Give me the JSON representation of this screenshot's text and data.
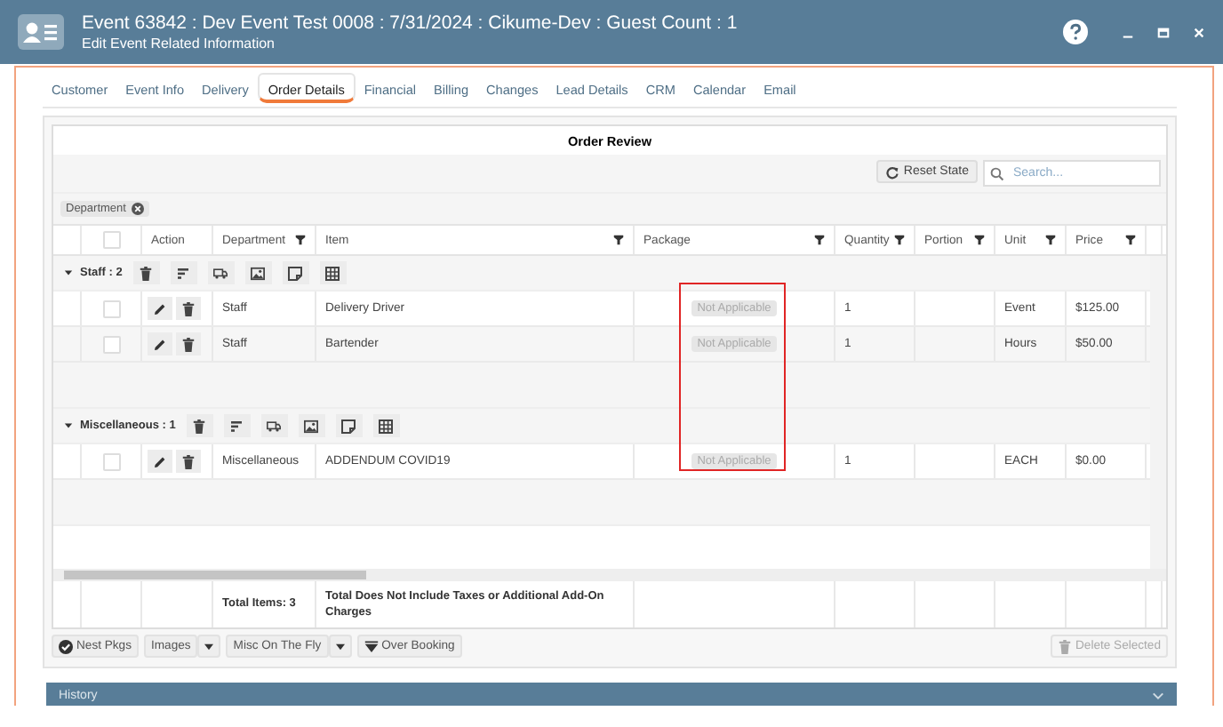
{
  "header": {
    "title": "Event 63842 : Dev Event Test 0008 : 7/31/2024 : Cikume-Dev : Guest Count : 1",
    "subtitle": "Edit Event Related Information"
  },
  "tabs": [
    {
      "label": "Customer",
      "selected": false
    },
    {
      "label": "Event Info",
      "selected": false
    },
    {
      "label": "Delivery",
      "selected": false
    },
    {
      "label": "Order Details",
      "selected": true
    },
    {
      "label": "Financial",
      "selected": false
    },
    {
      "label": "Billing",
      "selected": false
    },
    {
      "label": "Changes",
      "selected": false
    },
    {
      "label": "Lead Details",
      "selected": false
    },
    {
      "label": "CRM",
      "selected": false
    },
    {
      "label": "Calendar",
      "selected": false
    },
    {
      "label": "Email",
      "selected": false
    }
  ],
  "grid": {
    "title": "Order Review",
    "reset_button": "Reset State",
    "search": {
      "placeholder": "Search..."
    },
    "group_chip": "Department",
    "select_all_checked": false,
    "columns": [
      {
        "label": "Action",
        "filter": false
      },
      {
        "label": "Department",
        "filter": true
      },
      {
        "label": "Item",
        "filter": true
      },
      {
        "label": "Package",
        "filter": true
      },
      {
        "label": "Quantity",
        "filter": true
      },
      {
        "label": "Portion",
        "filter": true
      },
      {
        "label": "Unit",
        "filter": true
      },
      {
        "label": "Price",
        "filter": true
      }
    ],
    "groups": [
      {
        "label": "Staff : 2",
        "expanded": true,
        "rows": [
          {
            "checked": false,
            "department": "Staff",
            "item": "Delivery Driver",
            "package": "Not Applicable",
            "quantity": "1",
            "unit": "Event",
            "price": "$125.00"
          },
          {
            "checked": false,
            "department": "Staff",
            "item": "Bartender",
            "package": "Not Applicable",
            "quantity": "1",
            "unit": "Hours",
            "price": "$50.00"
          }
        ]
      },
      {
        "label": "Miscellaneous : 1",
        "expanded": true,
        "rows": [
          {
            "checked": false,
            "department": "Miscellaneous",
            "item": "ADDENDUM COVID19",
            "package": "Not Applicable",
            "quantity": "1",
            "unit": "EACH",
            "price": "$0.00"
          }
        ]
      }
    ],
    "footer": {
      "total_items": "Total Items: 3",
      "note": "Total Does Not Include Taxes or Additional Add-On Charges"
    }
  },
  "buttons": [
    {
      "label": "Nest Pkgs",
      "kind": "check"
    },
    {
      "label": "Images",
      "kind": "dropdown"
    },
    {
      "label": "Misc On The Fly",
      "kind": "dropdown"
    },
    {
      "label": "Over Booking",
      "kind": "booking"
    }
  ],
  "delete_button": {
    "label": "Delete Selected",
    "disabled": true
  },
  "history": {
    "label": "History",
    "expanded": false
  },
  "highlight": true
}
